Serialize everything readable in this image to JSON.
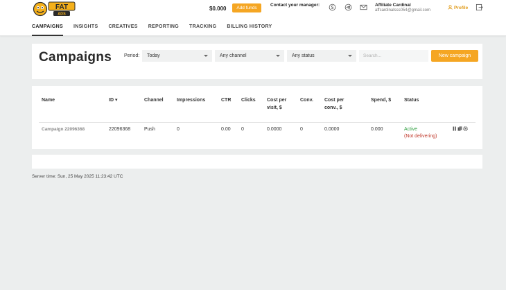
{
  "header": {
    "logo_text": "FAT ADS",
    "balance": "$0.000",
    "add_funds_label": "Add funds",
    "contact_label": "Contact your manager:",
    "user_name": "Affiliate Cardinal",
    "user_email": "affcardinalsss054@gmail.com",
    "profile_label": "Profile"
  },
  "nav": {
    "items": [
      {
        "label": "CAMPAIGNS",
        "active": true
      },
      {
        "label": "INSIGHTS"
      },
      {
        "label": "CREATIVES"
      },
      {
        "label": "REPORTING"
      },
      {
        "label": "TRACKING"
      },
      {
        "label": "BILLING HISTORY"
      }
    ]
  },
  "filters": {
    "title": "Campaigns",
    "period_label": "Period:",
    "period_value": "Today",
    "channel_value": "Any channel",
    "status_value": "Any status",
    "search_placeholder": "Search...",
    "new_campaign_label": "New campaign"
  },
  "table": {
    "headers": {
      "name": "Name",
      "id": "ID ▾",
      "channel": "Channel",
      "impressions": "Impressions",
      "ctr": "CTR",
      "clicks": "Clicks",
      "cost_per_visit": "Cost per visit, $",
      "conv": "Conv.",
      "cost_per_conv": "Cost per conv., $",
      "spend": "Spend, $",
      "status": "Status"
    },
    "rows": [
      {
        "name": "Campaign 22096368",
        "id": "22096368",
        "channel": "Push",
        "impressions": "0",
        "ctr": "0.00",
        "clicks": "0",
        "cost_per_visit": "0.0000",
        "conv": "0",
        "cost_per_conv": "0.0000",
        "spend": "0.000",
        "status": "Active",
        "status_note": "(Not delivering)"
      }
    ]
  },
  "footer": {
    "server_time": "Server time: Sun, 25 May 2025 11:23:42 UTC"
  },
  "colors": {
    "accent": "#f5a623",
    "active": "#2e9e3f",
    "warning": "#c0392b"
  }
}
